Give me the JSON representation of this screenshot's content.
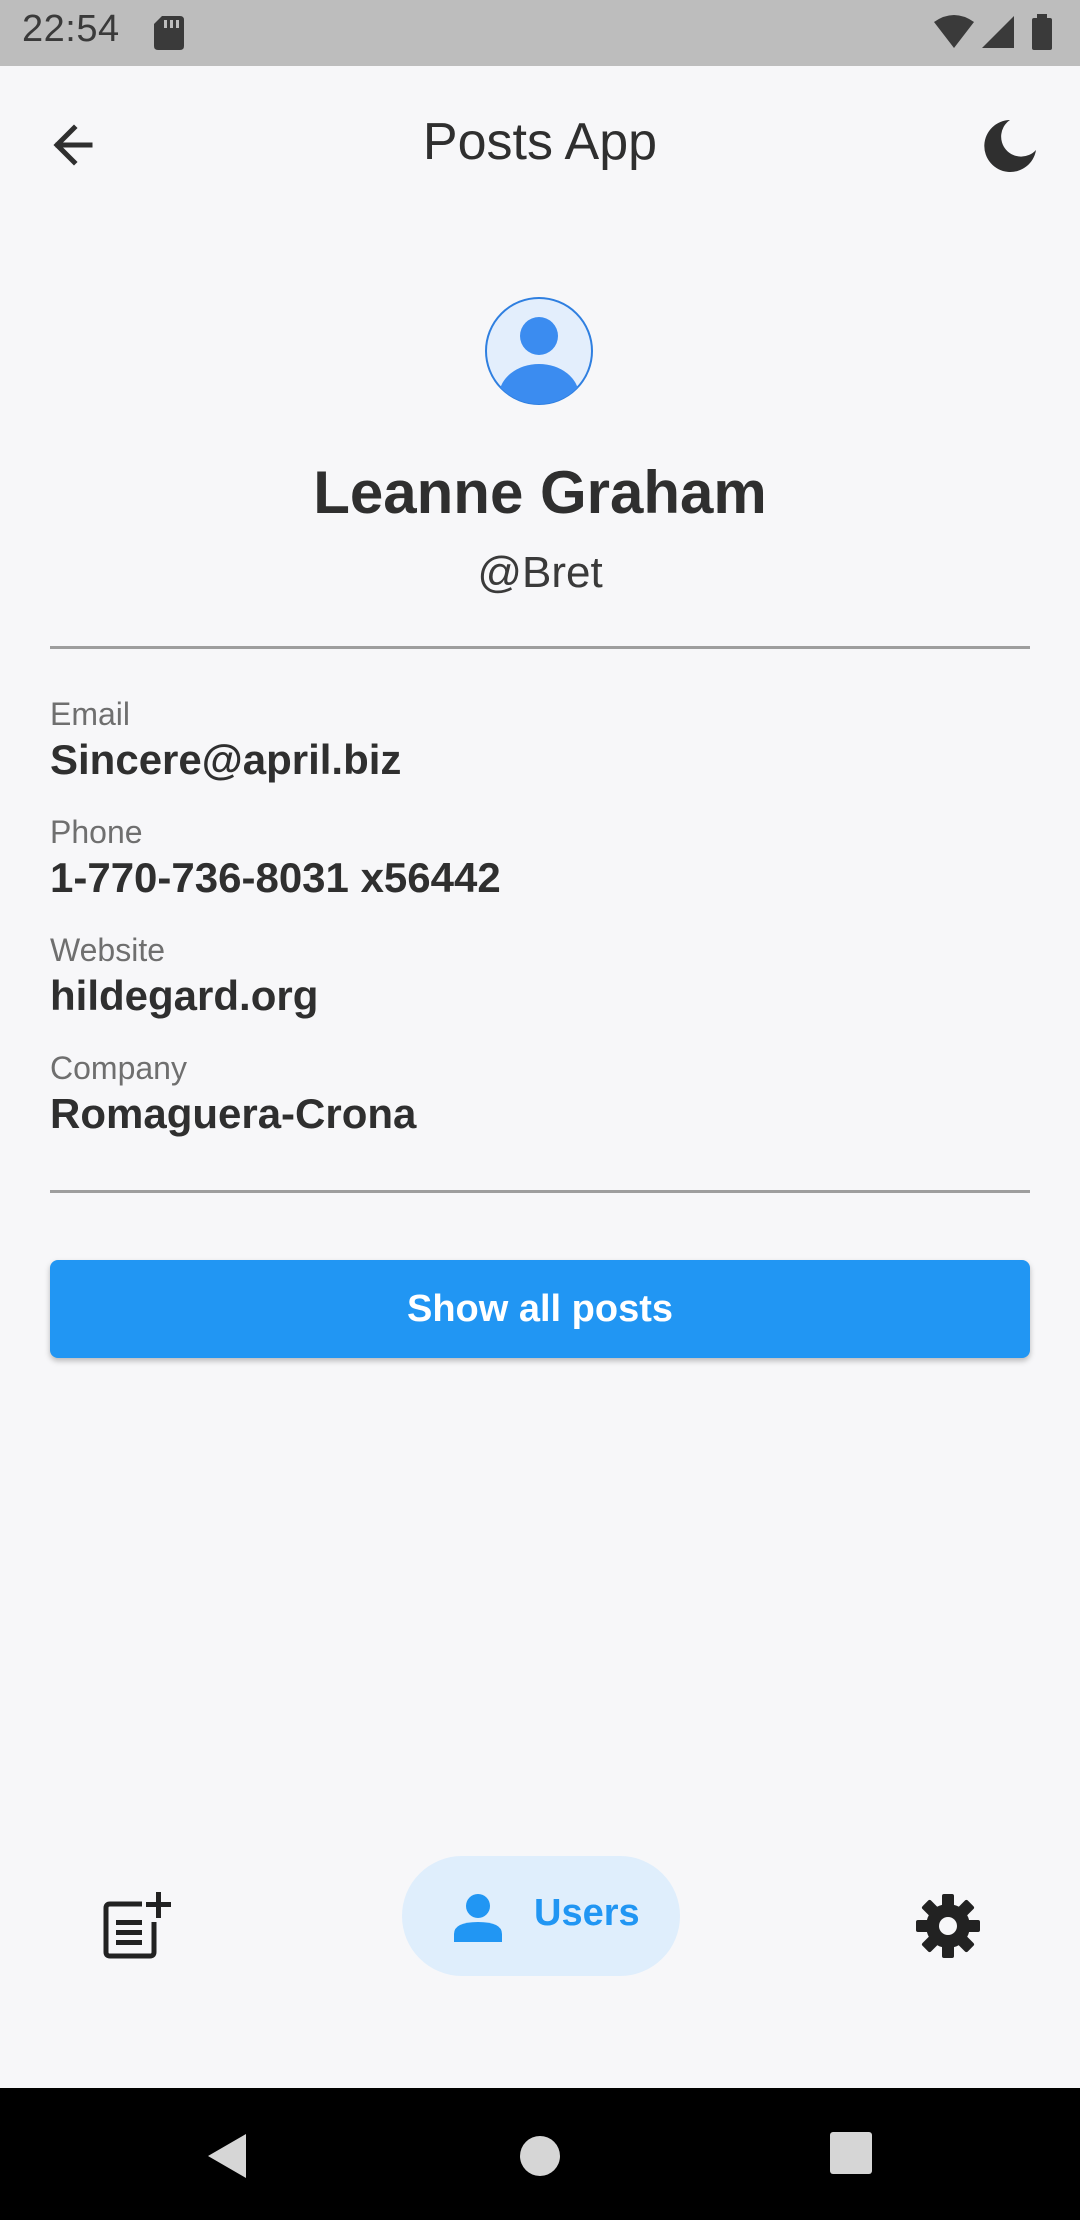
{
  "status_bar": {
    "time": "22:54",
    "icons": [
      "sd-card-icon",
      "wifi-icon",
      "signal-icon",
      "battery-icon"
    ]
  },
  "app_bar": {
    "title": "Posts App",
    "back_icon": "arrow-back-icon",
    "theme_icon": "moon-icon"
  },
  "profile": {
    "avatar_icon": "account-circle-icon",
    "name": "Leanne Graham",
    "username": "@Bret"
  },
  "details": [
    {
      "label": "Email",
      "value": "Sincere@april.biz"
    },
    {
      "label": "Phone",
      "value": "1-770-736-8031 x56442"
    },
    {
      "label": "Website",
      "value": "hildegard.org"
    },
    {
      "label": "Company",
      "value": "Romaguera-Crona"
    }
  ],
  "actions": {
    "show_posts_label": "Show all posts"
  },
  "bottom_nav": {
    "items": [
      {
        "icon": "post-add-icon",
        "label": "",
        "selected": false
      },
      {
        "icon": "person-icon",
        "label": "Users",
        "selected": true
      },
      {
        "icon": "gear-icon",
        "label": "",
        "selected": false
      }
    ]
  },
  "colors": {
    "accent": "#2196f3",
    "accent_soft": "#dfeefc",
    "background": "#f7f7f9",
    "text": "#2f2f2f"
  }
}
